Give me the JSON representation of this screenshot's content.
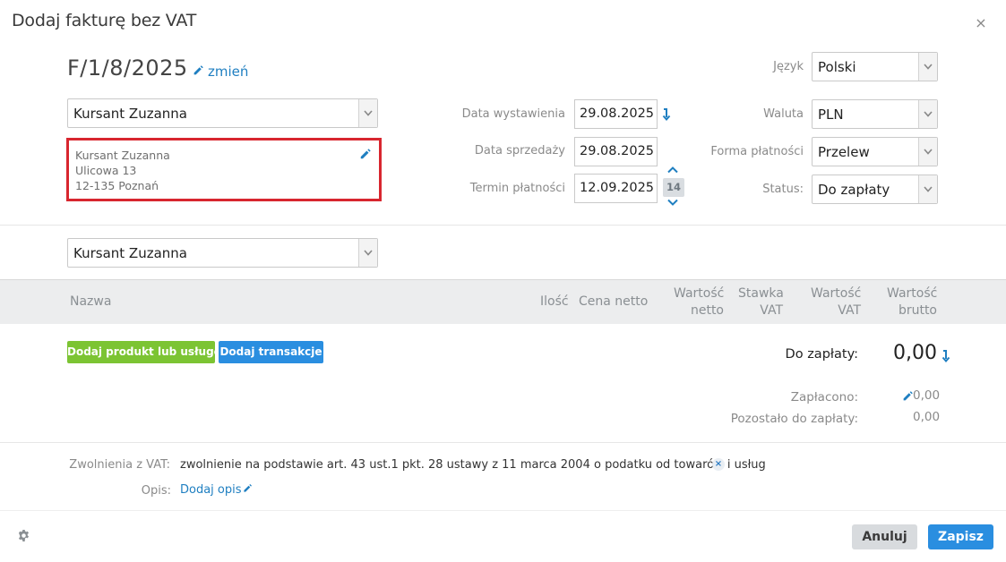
{
  "dialog": {
    "title": "Dodaj fakturę bez VAT",
    "close_icon": "×"
  },
  "invoice": {
    "number": "F/1/8/2025",
    "change_label": "zmień"
  },
  "client": {
    "selected": "Kursant Zuzanna",
    "address_lines": [
      "Kursant Zuzanna",
      "Ulicowa 13",
      "12-135 Poznań"
    ]
  },
  "dates": {
    "issue_label": "Data wystawienia",
    "issue_value": "29.08.2025",
    "sale_label": "Data sprzedaży",
    "sale_value": "29.08.2025",
    "due_label": "Termin płatności",
    "due_value": "12.09.2025",
    "due_days": "14"
  },
  "settings": {
    "language_label": "Język",
    "language_value": "Polski",
    "currency_label": "Waluta",
    "currency_value": "PLN",
    "payment_label": "Forma płatności",
    "payment_value": "Przelew",
    "status_label": "Status:",
    "status_value": "Do zapłaty"
  },
  "recipient": {
    "selected": "Kursant Zuzanna"
  },
  "table": {
    "columns": {
      "name": "Nazwa",
      "qty": "Ilość",
      "net_price": "Cena netto",
      "net_value": "Wartość netto",
      "vat_rate": "Stawka VAT",
      "vat_value": "Wartość VAT",
      "gross_value": "Wartość brutto"
    }
  },
  "actions": {
    "add_product": "Dodaj produkt lub usługę",
    "add_transaction": "Dodaj transakcje"
  },
  "totals": {
    "due_label": "Do zapłaty:",
    "due_amount": "0,00",
    "paid_label": "Zapłacono:",
    "paid_value": "0,00",
    "remaining_label": "Pozostało do zapłaty:",
    "remaining_value": "0,00"
  },
  "exemption": {
    "label": "Zwolnienia z VAT:",
    "text": "zwolnienie na podstawie art. 43 ust.1 pkt. 28 ustawy z 11 marca 2004 o podatku od towarów i usług"
  },
  "description": {
    "label": "Opis:",
    "add_link": "Dodaj opis"
  },
  "footer": {
    "cancel": "Anuluj",
    "save": "Zapisz"
  },
  "colors": {
    "accent_blue": "#2a8ee0",
    "link_blue": "#1f7fc1",
    "green": "#7cc433",
    "highlight_red": "#d8262f"
  }
}
